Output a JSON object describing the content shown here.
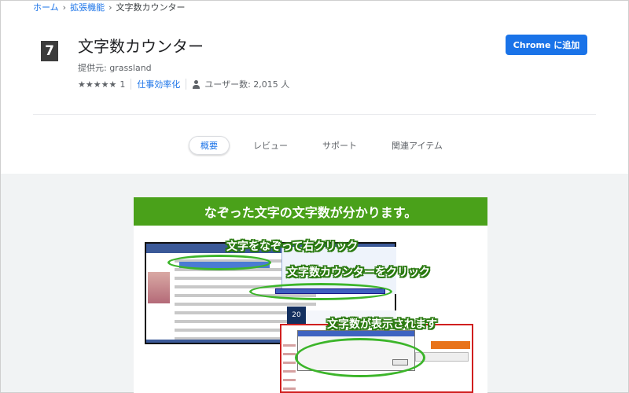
{
  "breadcrumb": {
    "home": "ホーム",
    "sep1": "›",
    "extensions": "拡張機能",
    "sep2": "›",
    "current": "文字数カウンター"
  },
  "extension": {
    "icon_text": "7",
    "title": "文字数カウンター",
    "provider": "提供元: grassland",
    "stars": "★★★★★",
    "rating_count": "1",
    "category": "仕事効率化",
    "users": "ユーザー数: 2,015 人",
    "add_button": "Chrome に追加"
  },
  "tabs": [
    {
      "label": "概要",
      "active": true
    },
    {
      "label": "レビュー",
      "active": false
    },
    {
      "label": "サポート",
      "active": false
    },
    {
      "label": "関連アイテム",
      "active": false
    }
  ],
  "screenshot": {
    "header": "なぞった文字の文字数が分かります。",
    "callout1": "文字をなぞって右クリック",
    "callout2": "文字数カウンターをクリック",
    "callout3": "文字数が表示されます",
    "years": "20"
  },
  "colors": {
    "accent": "#1a73e8",
    "banner_green": "#4aa11a",
    "ellipse_green": "#3cb52a"
  }
}
